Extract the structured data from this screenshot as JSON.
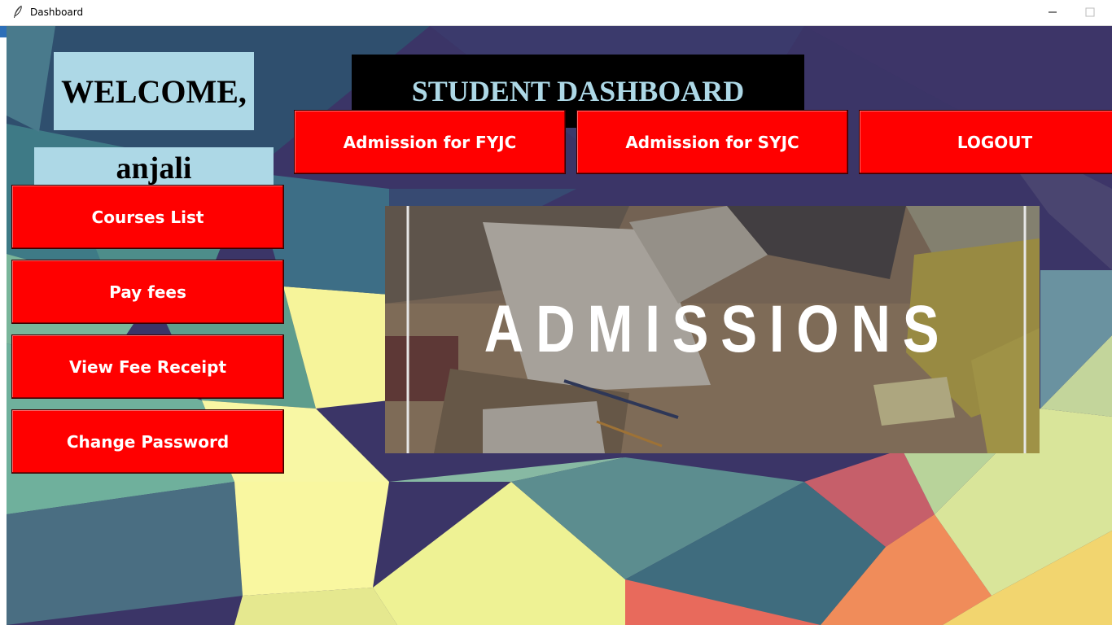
{
  "window": {
    "title": "Dashboard",
    "icon": "feather-icon",
    "controls": [
      "minimize-icon",
      "maximize-icon"
    ]
  },
  "welcome": {
    "greeting": "WELCOME,",
    "username": "anjali"
  },
  "header": {
    "title": "STUDENT DASHBOARD"
  },
  "top_buttons": {
    "fyjc": "Admission for FYJC",
    "syjc": "Admission for SYJC",
    "logout": "LOGOUT"
  },
  "side_buttons": {
    "courses": "Courses List",
    "pay_fees": "Pay fees",
    "view_receipt": "View Fee Receipt",
    "change_password": "Change Password"
  },
  "banner": {
    "text": "ADMISSIONS"
  },
  "colors": {
    "button_bg": "#ff0000",
    "button_text": "#ffffff",
    "label_bg": "#add8e6",
    "header_bg": "#000000",
    "header_text": "#add8e6"
  }
}
